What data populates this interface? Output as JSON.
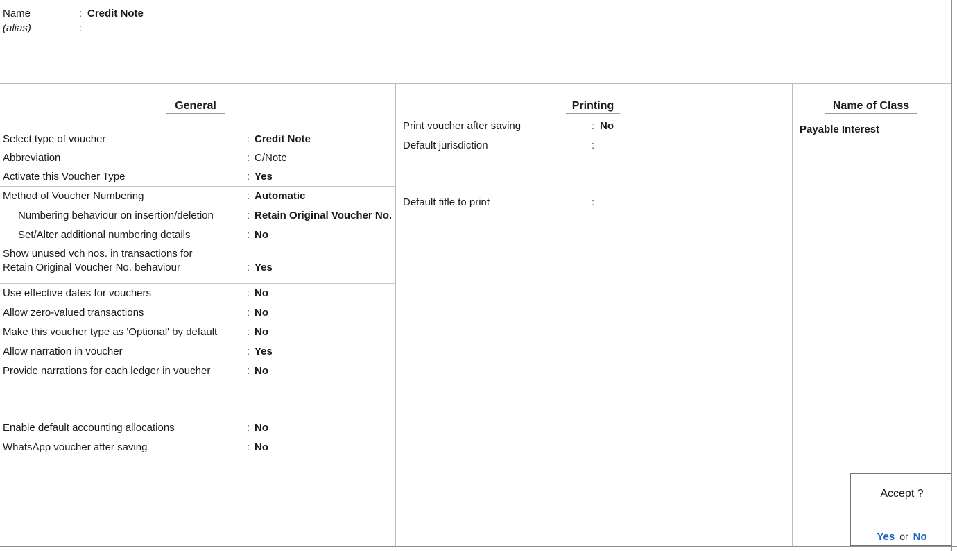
{
  "title_block": {
    "name_label": "Name",
    "name_colon": ":",
    "name_value": "Credit Note",
    "alias_label": "(alias)",
    "alias_colon": ":",
    "alias_value": ""
  },
  "columns": {
    "general": {
      "heading": "General",
      "rows": [
        {
          "label": "Select type of voucher",
          "colon": ":",
          "value": "Credit Note",
          "bold": true
        },
        {
          "label": "Abbreviation",
          "colon": ":",
          "value": "C/Note",
          "bold": false
        },
        {
          "label": "Activate this Voucher Type",
          "colon": ":",
          "value": "Yes",
          "bold": true
        },
        {
          "label": "Method of Voucher Numbering",
          "colon": ":",
          "value": "Automatic",
          "bold": true
        },
        {
          "label": "Numbering behaviour on insertion/deletion",
          "colon": ":",
          "value": "Retain Original Voucher No.",
          "bold": true
        },
        {
          "label": "Set/Alter additional numbering details",
          "colon": ":",
          "value": "No",
          "bold": true
        },
        {
          "label_line1": "Show unused vch nos. in transactions for",
          "label_line2": "Retain Original Voucher No. behaviour",
          "colon": ":",
          "value": "Yes",
          "bold": true
        },
        {
          "label": "Use effective dates for vouchers",
          "colon": ":",
          "value": "No",
          "bold": true
        },
        {
          "label": "Allow zero-valued transactions",
          "colon": ":",
          "value": "No",
          "bold": true
        },
        {
          "label": "Make this voucher type as 'Optional' by default",
          "colon": ":",
          "value": "No",
          "bold": true
        },
        {
          "label": "Allow narration in voucher",
          "colon": ":",
          "value": "Yes",
          "bold": true
        },
        {
          "label": "Provide narrations for each ledger in voucher",
          "colon": ":",
          "value": "No",
          "bold": true
        },
        {
          "label": "Enable default accounting allocations",
          "colon": ":",
          "value": "No",
          "bold": true
        },
        {
          "label": "WhatsApp voucher after saving",
          "colon": ":",
          "value": "No",
          "bold": true
        }
      ]
    },
    "printing": {
      "heading": "Printing",
      "rows": [
        {
          "label": "Print voucher after saving",
          "colon": ":",
          "value": "No",
          "bold": true
        },
        {
          "label": "Default jurisdiction",
          "colon": ":",
          "value": "",
          "bold": false
        },
        {
          "label": "Default title to print",
          "colon": ":",
          "value": "",
          "bold": false
        }
      ]
    },
    "name_of_class": {
      "heading": "Name of Class",
      "entries": [
        {
          "label": "Payable Interest"
        }
      ]
    }
  },
  "accept_dialog": {
    "title": "Accept ?",
    "yes_label": "Yes",
    "or_label": "or",
    "no_label": "No",
    "link_color": "#1f5fbf"
  }
}
